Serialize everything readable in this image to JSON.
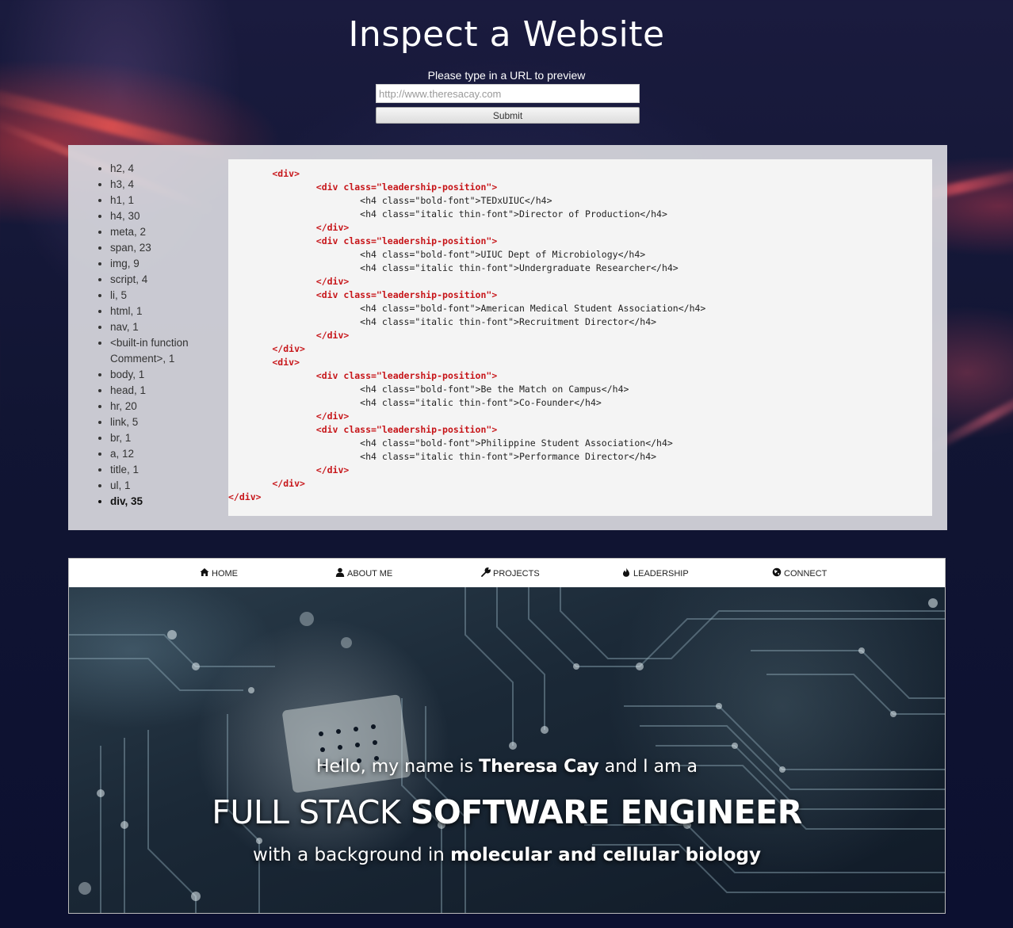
{
  "page": {
    "title": "Inspect a Website"
  },
  "form": {
    "prompt": "Please type in a URL to preview",
    "url_placeholder": "http://www.theresacay.com",
    "submit_label": "Submit"
  },
  "tag_counts": [
    {
      "label": "h2, 4",
      "bold": false
    },
    {
      "label": "h3, 4",
      "bold": false
    },
    {
      "label": "h1, 1",
      "bold": false
    },
    {
      "label": "h4, 30",
      "bold": false
    },
    {
      "label": "meta, 2",
      "bold": false
    },
    {
      "label": "span, 23",
      "bold": false
    },
    {
      "label": "img, 9",
      "bold": false
    },
    {
      "label": "script, 4",
      "bold": false
    },
    {
      "label": "li, 5",
      "bold": false
    },
    {
      "label": "html, 1",
      "bold": false
    },
    {
      "label": "nav, 1",
      "bold": false
    },
    {
      "label": "<built-in function Comment>, 1",
      "bold": false
    },
    {
      "label": "body, 1",
      "bold": false
    },
    {
      "label": "head, 1",
      "bold": false
    },
    {
      "label": "hr, 20",
      "bold": false
    },
    {
      "label": "link, 5",
      "bold": false
    },
    {
      "label": "br, 1",
      "bold": false
    },
    {
      "label": "a, 12",
      "bold": false
    },
    {
      "label": "title, 1",
      "bold": false
    },
    {
      "label": "ul, 1",
      "bold": false
    },
    {
      "label": "div, 35",
      "bold": true
    }
  ],
  "source_code": [
    {
      "text": "        <div>",
      "highlight": true
    },
    {
      "text": "                <div class=\"leadership-position\">",
      "highlight": true
    },
    {
      "text": "                        <h4 class=\"bold-font\">TEDxUIUC</h4>",
      "highlight": false
    },
    {
      "text": "                        <h4 class=\"italic thin-font\">Director of Production</h4>",
      "highlight": false
    },
    {
      "text": "                </div>",
      "highlight": true
    },
    {
      "text": "                <div class=\"leadership-position\">",
      "highlight": true
    },
    {
      "text": "                        <h4 class=\"bold-font\">UIUC Dept of Microbiology</h4>",
      "highlight": false
    },
    {
      "text": "                        <h4 class=\"italic thin-font\">Undergraduate Researcher</h4>",
      "highlight": false
    },
    {
      "text": "                </div>",
      "highlight": true
    },
    {
      "text": "                <div class=\"leadership-position\">",
      "highlight": true
    },
    {
      "text": "                        <h4 class=\"bold-font\">American Medical Student Association</h4>",
      "highlight": false
    },
    {
      "text": "                        <h4 class=\"italic thin-font\">Recruitment Director</h4>",
      "highlight": false
    },
    {
      "text": "                </div>",
      "highlight": true
    },
    {
      "text": "        </div>",
      "highlight": true
    },
    {
      "text": "        <div>",
      "highlight": true
    },
    {
      "text": "                <div class=\"leadership-position\">",
      "highlight": true
    },
    {
      "text": "                        <h4 class=\"bold-font\">Be the Match on Campus</h4>",
      "highlight": false
    },
    {
      "text": "                        <h4 class=\"italic thin-font\">Co-Founder</h4>",
      "highlight": false
    },
    {
      "text": "                </div>",
      "highlight": true
    },
    {
      "text": "                <div class=\"leadership-position\">",
      "highlight": true
    },
    {
      "text": "                        <h4 class=\"bold-font\">Philippine Student Association</h4>",
      "highlight": false
    },
    {
      "text": "                        <h4 class=\"italic thin-font\">Performance Director</h4>",
      "highlight": false
    },
    {
      "text": "                </div>",
      "highlight": true
    },
    {
      "text": "        </div>",
      "highlight": true
    },
    {
      "text": "</div>",
      "highlight": true
    }
  ],
  "preview": {
    "nav": [
      {
        "label": "HOME",
        "icon": "home-icon"
      },
      {
        "label": "ABOUT ME",
        "icon": "user-icon"
      },
      {
        "label": "PROJECTS",
        "icon": "wrench-icon"
      },
      {
        "label": "LEADERSHIP",
        "icon": "fire-icon"
      },
      {
        "label": "CONNECT",
        "icon": "globe-icon"
      }
    ],
    "hero": {
      "line1_a": "Hello, my name is ",
      "line1_name": "Theresa Cay",
      "line1_b": " and I am a",
      "line2_a": "FULL STACK ",
      "line2_b": "SOFTWARE ENGINEER",
      "line3_a": "with a background in ",
      "line3_b": "molecular and cellular biology"
    }
  },
  "colors": {
    "code_tag": "#c7161a",
    "panel_bg": "#d7d7de",
    "page_bg": "#111533"
  }
}
